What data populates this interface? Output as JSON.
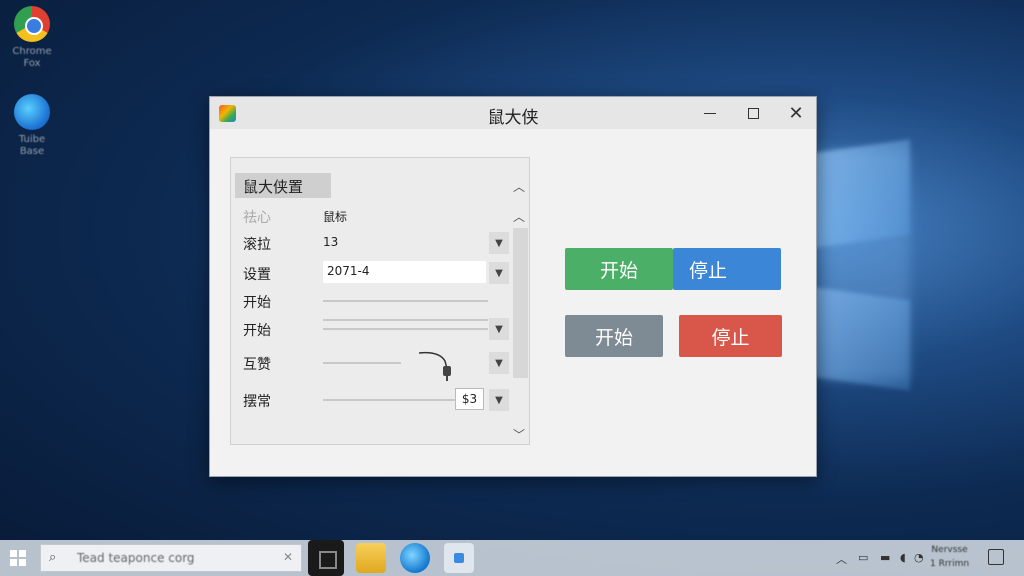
{
  "desktop": {
    "icons": [
      {
        "label": "Chrome\nFox",
        "icon": "chrome-icon"
      },
      {
        "label": "Tuibe\nBase",
        "icon": "edge-icon"
      }
    ]
  },
  "window": {
    "title": "鼠大侠",
    "icon": "app-logo-icon",
    "controls": {
      "minimize": "minimize-icon",
      "maximize": "maximize-icon",
      "close": "✕"
    }
  },
  "settings": {
    "header": "鼠大侠置",
    "rows": [
      {
        "label": "祛心",
        "value": "鼠标"
      },
      {
        "label": "滚拉",
        "value": "13"
      },
      {
        "label": "设置",
        "value": "2071-4"
      },
      {
        "label": "开始"
      },
      {
        "label": "开始"
      },
      {
        "label": "互赞"
      },
      {
        "label": "摆常",
        "value": "$3"
      }
    ]
  },
  "buttons": {
    "start_primary": "开始",
    "stop_primary": "停止",
    "start_secondary": "开始",
    "stop_secondary": "停止"
  },
  "taskbar": {
    "search_placeholder": "Tead teaponce corg",
    "clock": "Nervsse\n1 Rrrimn"
  },
  "colors": {
    "green": "#4caf68",
    "blue": "#3b86d6",
    "gray": "#7e8a94",
    "red": "#d8574a"
  }
}
